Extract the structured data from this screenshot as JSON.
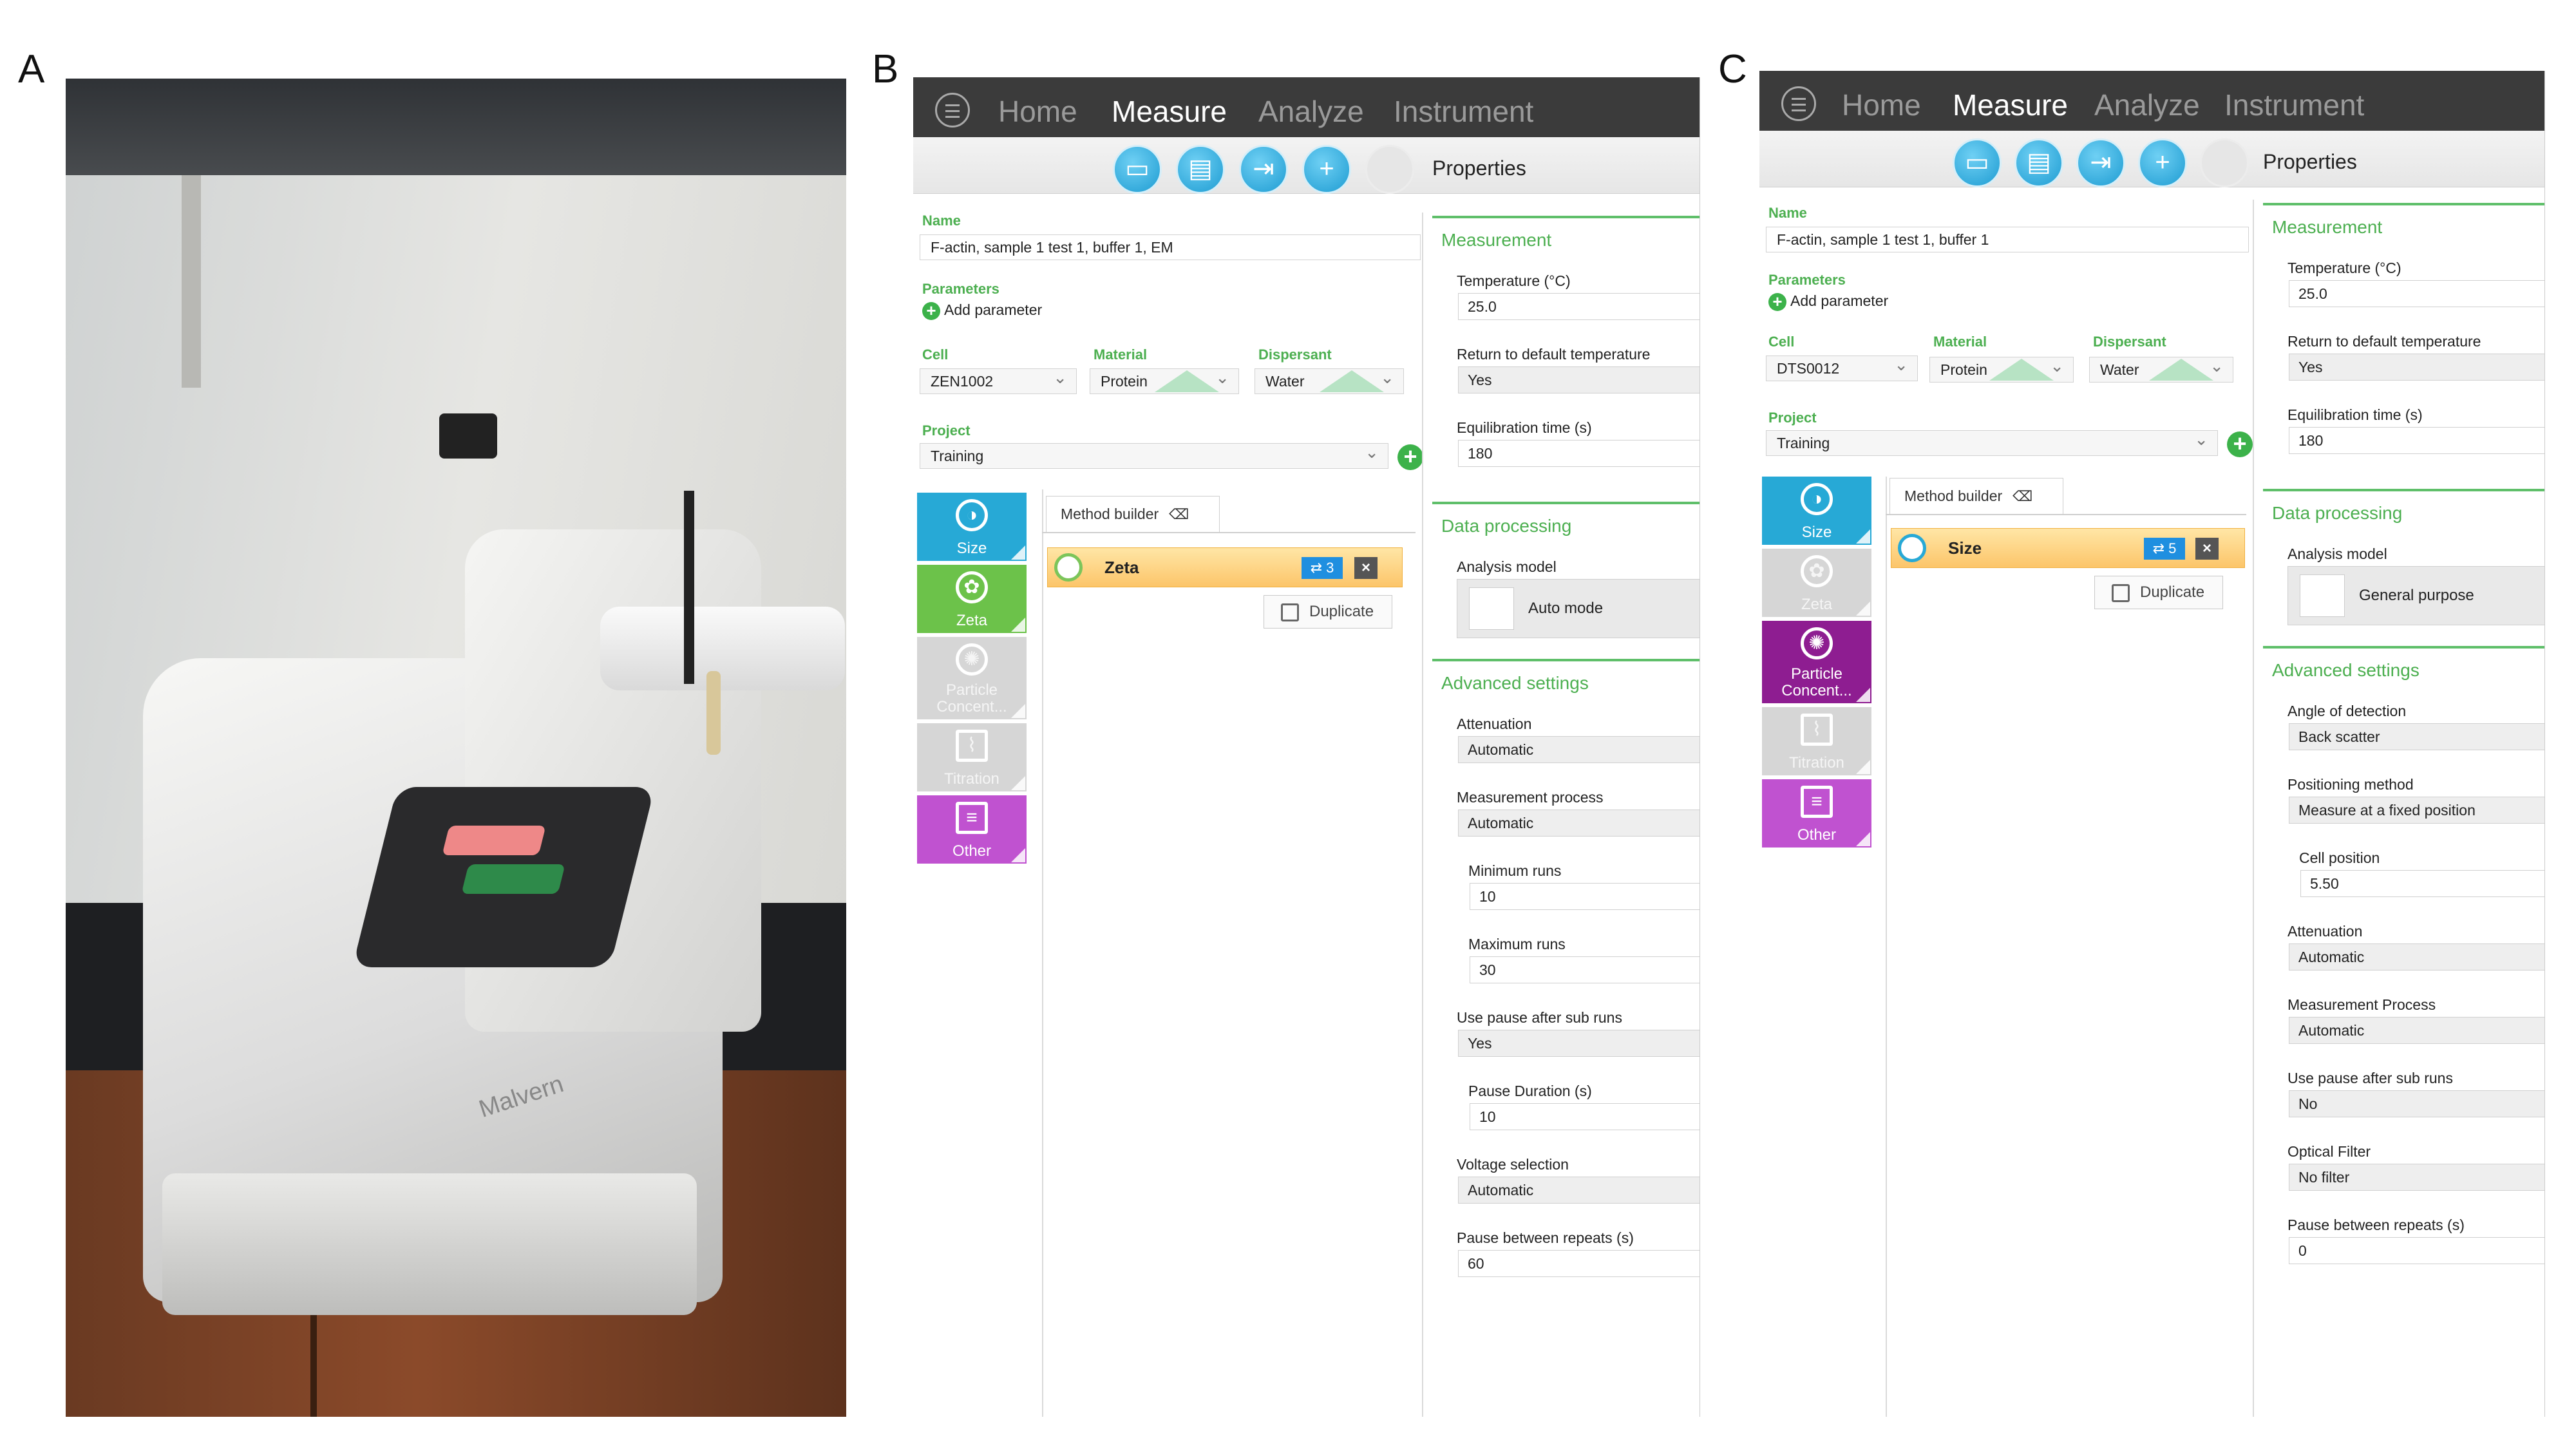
{
  "panel_labels": {
    "a": "A",
    "b": "B",
    "c": "C"
  },
  "photo": {
    "brand_logo": "Malvern"
  },
  "nav": {
    "home": "Home",
    "measure": "Measure",
    "analyze": "Analyze",
    "instrument": "Instrument"
  },
  "toolbar": {
    "icons": [
      "open-folder-icon",
      "save-icon",
      "export-icon",
      "add-icon",
      "play-icon"
    ],
    "properties_title": "Properties"
  },
  "common_labels": {
    "name": "Name",
    "parameters": "Parameters",
    "add_parameter": "Add parameter",
    "cell": "Cell",
    "material": "Material",
    "dispersant": "Dispersant",
    "project": "Project",
    "method_builder": "Method builder",
    "duplicate": "Duplicate",
    "measurement": "Measurement",
    "data_processing": "Data processing",
    "advanced_settings": "Advanced settings",
    "analysis_model": "Analysis model"
  },
  "panel_b": {
    "name_value": "F-actin, sample 1 test 1, buffer 1, EM",
    "cell_value": "ZEN1002",
    "material_value": "Protein",
    "dispersant_value": "Water",
    "project_value": "Training",
    "tiles": [
      {
        "label": "Size",
        "style": "size"
      },
      {
        "label": "Zeta",
        "style": "zeta"
      },
      {
        "label": "Particle Concent...",
        "style": "gray"
      },
      {
        "label": "Titration",
        "style": "gray"
      },
      {
        "label": "Other",
        "style": "magenta"
      }
    ],
    "method_item": {
      "label": "Zeta",
      "repeats": "3"
    },
    "measurement": [
      {
        "label": "Temperature (°C)",
        "value": "25.0",
        "kind": "text"
      },
      {
        "label": "Return to default temperature",
        "value": "Yes",
        "kind": "select"
      },
      {
        "label": "Equilibration time (s)",
        "value": "180",
        "kind": "text"
      }
    ],
    "analysis_model_value": "Auto mode",
    "advanced": [
      {
        "label": "Attenuation",
        "value": "Automatic",
        "kind": "select",
        "indent": false
      },
      {
        "label": "Measurement process",
        "value": "Automatic",
        "kind": "select",
        "indent": false
      },
      {
        "label": "Minimum runs",
        "value": "10",
        "kind": "text",
        "indent": true
      },
      {
        "label": "Maximum runs",
        "value": "30",
        "kind": "text",
        "indent": true
      },
      {
        "label": "Use pause after sub runs",
        "value": "Yes",
        "kind": "select",
        "indent": false
      },
      {
        "label": "Pause Duration (s)",
        "value": "10",
        "kind": "text",
        "indent": true
      },
      {
        "label": "Voltage selection",
        "value": "Automatic",
        "kind": "select",
        "indent": false
      },
      {
        "label": "Pause between repeats (s)",
        "value": "60",
        "kind": "text",
        "indent": false
      }
    ]
  },
  "panel_c": {
    "name_value": "F-actin, sample 1 test 1, buffer 1",
    "cell_value": "DTS0012",
    "material_value": "Protein",
    "dispersant_value": "Water",
    "project_value": "Training",
    "tiles": [
      {
        "label": "Size",
        "style": "size"
      },
      {
        "label": "Zeta",
        "style": "gray"
      },
      {
        "label": "Particle Concent...",
        "style": "purple"
      },
      {
        "label": "Titration",
        "style": "gray"
      },
      {
        "label": "Other",
        "style": "magenta"
      }
    ],
    "method_item": {
      "label": "Size",
      "repeats": "5"
    },
    "measurement": [
      {
        "label": "Temperature (°C)",
        "value": "25.0",
        "kind": "text"
      },
      {
        "label": "Return to default temperature",
        "value": "Yes",
        "kind": "select"
      },
      {
        "label": "Equilibration time (s)",
        "value": "180",
        "kind": "text"
      }
    ],
    "analysis_model_value": "General purpose",
    "advanced": [
      {
        "label": "Angle of detection",
        "value": "Back scatter",
        "kind": "select",
        "indent": false
      },
      {
        "label": "Positioning method",
        "value": "Measure at a fixed position",
        "kind": "select",
        "indent": false
      },
      {
        "label": "Cell position",
        "value": "5.50",
        "kind": "text",
        "indent": true
      },
      {
        "label": "Attenuation",
        "value": "Automatic",
        "kind": "select",
        "indent": false
      },
      {
        "label": "Measurement Process",
        "value": "Automatic",
        "kind": "select",
        "indent": false
      },
      {
        "label": "Use pause after sub runs",
        "value": "No",
        "kind": "select",
        "indent": false
      },
      {
        "label": "Optical Filter",
        "value": "No filter",
        "kind": "select",
        "indent": false
      },
      {
        "label": "Pause between repeats (s)",
        "value": "0",
        "kind": "text",
        "indent": false
      }
    ]
  }
}
